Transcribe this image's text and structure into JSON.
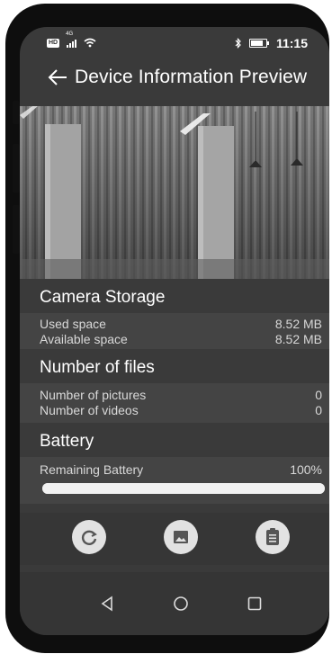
{
  "status_bar": {
    "hd_badge": "HD",
    "network_type": "4G",
    "time": "11:15",
    "icons": [
      "signal-icon",
      "wifi-icon",
      "bluetooth-icon",
      "battery-icon"
    ]
  },
  "app_bar": {
    "title": "Device Information Preview",
    "back_icon": "arrow-left-icon"
  },
  "preview": {
    "description_icon": "camera-preview-image"
  },
  "camera_storage": {
    "header": "Camera Storage",
    "used_label": "Used space",
    "used_value": "8.52 MB",
    "available_label": "Available space",
    "available_value": "8.52 MB"
  },
  "files": {
    "header": "Number of files",
    "pictures_label": "Number of pictures",
    "pictures_value": "0",
    "videos_label": "Number of videos",
    "videos_value": "0"
  },
  "battery": {
    "header": "Battery",
    "remaining_label": "Remaining Battery",
    "remaining_value": "100%",
    "level_fraction": 1.0
  },
  "actions": [
    "refresh-icon",
    "image-icon",
    "clipboard-icon"
  ],
  "nav": [
    "back-triangle-icon",
    "home-circle-icon",
    "recents-square-icon"
  ],
  "colors": {
    "background": "#3a3a3a",
    "row_background": "#444444",
    "action_circle": "#e2e2e2",
    "progress": "#e8e8e8"
  }
}
